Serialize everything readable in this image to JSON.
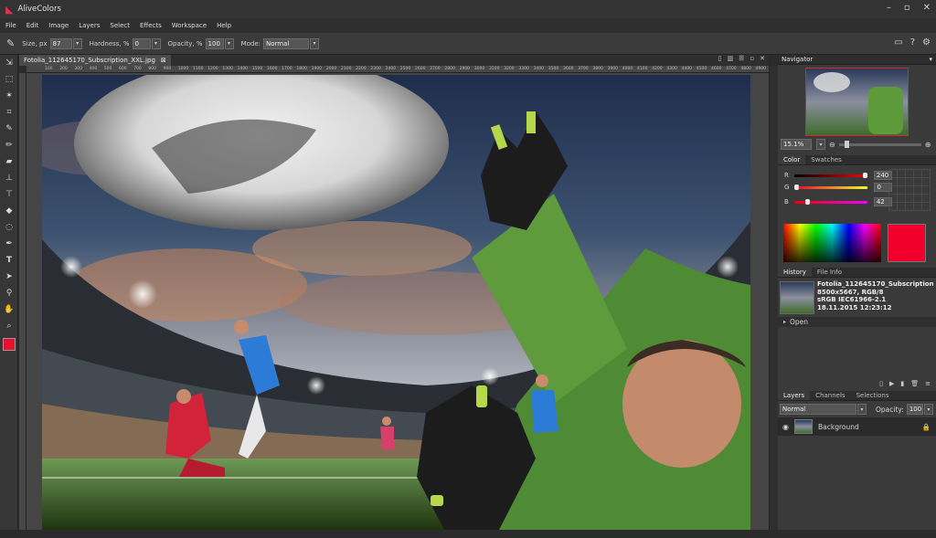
{
  "app": {
    "title": "AliveColors"
  },
  "menu": [
    "File",
    "Edit",
    "Image",
    "Layers",
    "Select",
    "Effects",
    "Workspace",
    "Help"
  ],
  "options": {
    "size_label": "Size, px",
    "size_value": "87",
    "hardness_label": "Hardness, %",
    "hardness_value": "0",
    "opacity_label": "Opacity, %",
    "opacity_value": "100",
    "mode_label": "Mode:",
    "mode_value": "Normal"
  },
  "document": {
    "tab_label": "Fotolia_112645170_Subscription_XXL.jpg",
    "close_glyph": "⊠"
  },
  "ruler": {
    "ticks": [
      "100",
      "200",
      "300",
      "400",
      "500",
      "600",
      "700",
      "800",
      "900",
      "1000",
      "1100",
      "1200",
      "1300",
      "1400",
      "1500",
      "1600",
      "1700",
      "1800",
      "1900",
      "2000",
      "2100",
      "2200",
      "2300",
      "2400",
      "2500",
      "2600",
      "2700",
      "2800",
      "2900",
      "3000",
      "3100",
      "3200",
      "3300",
      "3400",
      "3500",
      "3600",
      "3700",
      "3800",
      "3900",
      "4000",
      "4100",
      "4200",
      "4300",
      "4400",
      "4500",
      "4600",
      "4700",
      "4800",
      "4900",
      "5000",
      "5100",
      "5200",
      "5300",
      "5400",
      "5500",
      "5600",
      "5700",
      "5800",
      "5900",
      "6000",
      "6100",
      "6200",
      "6300",
      "6400",
      "6500",
      "6600",
      "6700",
      "6800",
      "6900",
      "7000",
      "7100",
      "7200",
      "7300",
      "7400",
      "7500",
      "7600",
      "7700",
      "7800",
      "7900",
      "8000",
      "8100",
      "8200",
      "8300",
      "8400",
      "8500"
    ]
  },
  "navigator": {
    "title": "Navigator",
    "zoom": "15.1%"
  },
  "color_panel": {
    "tabs": [
      "Color",
      "Swatches"
    ],
    "channels": [
      {
        "name": "R",
        "value": "240"
      },
      {
        "name": "G",
        "value": "0"
      },
      {
        "name": "B",
        "value": "42"
      }
    ],
    "swatch_color": "#f0002a"
  },
  "history_panel": {
    "tabs": [
      "History",
      "File Info"
    ],
    "file_name": "Fotolia_112645170_Subscription",
    "dimensions": "8500x5667, RGB/8",
    "profile": "sRGB IEC61966-2.1",
    "date": "18.11.2015 12:23:12",
    "items": [
      "Open"
    ]
  },
  "layers_panel": {
    "tabs": [
      "Layers",
      "Channels",
      "Selections"
    ],
    "blend_mode": "Normal",
    "opacity_label": "Opacity:",
    "opacity_value": "100",
    "layers": [
      {
        "name": "Background"
      }
    ]
  },
  "colors": {
    "accent": "#e8102e"
  }
}
